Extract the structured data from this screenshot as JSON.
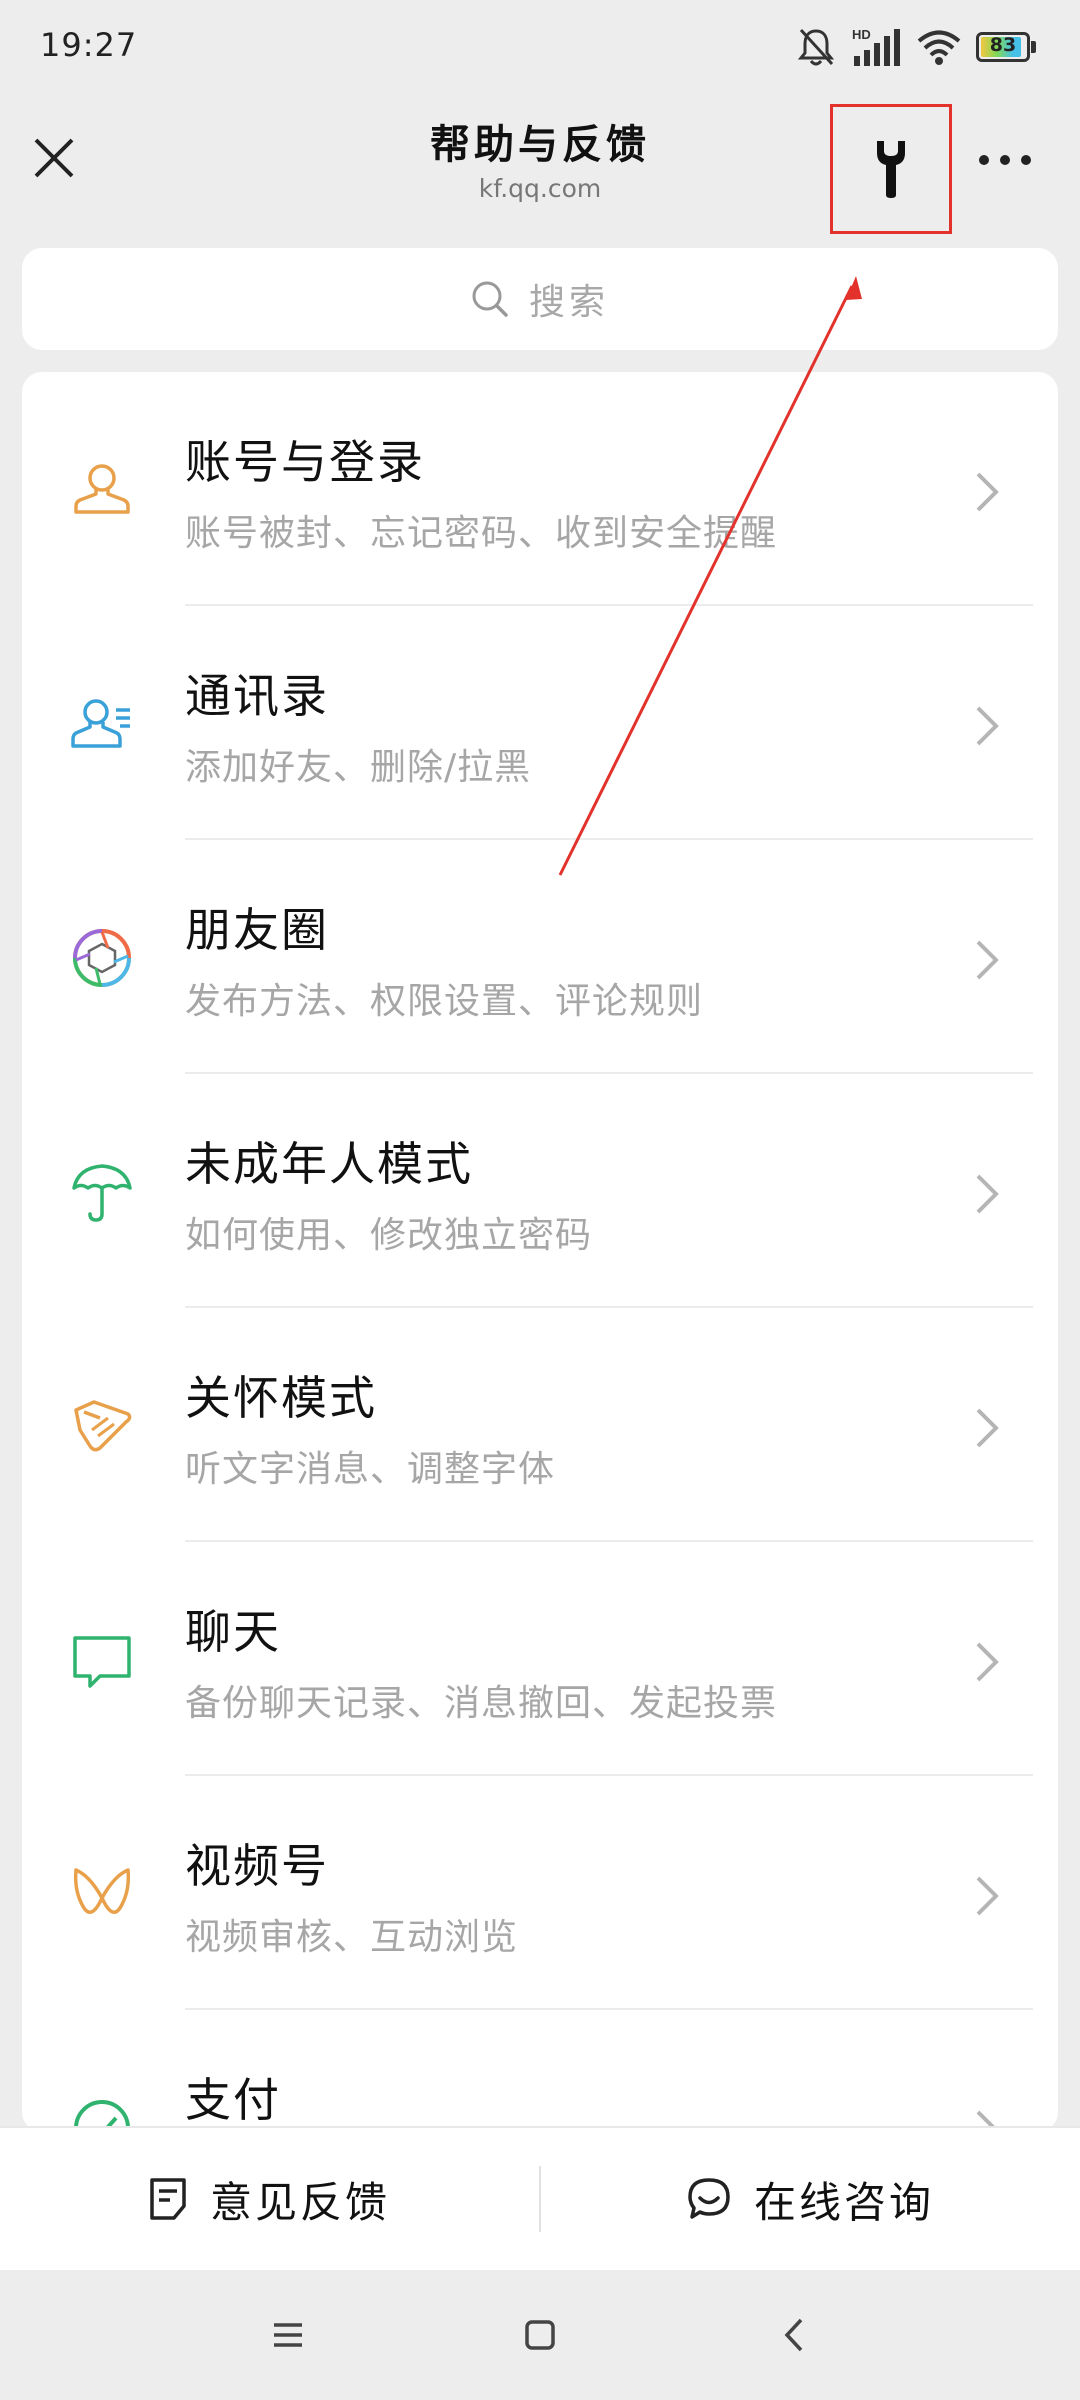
{
  "status_bar": {
    "time": "19:27",
    "network_label": "HD",
    "battery_level": "83",
    "icons": [
      "bell-muted-icon",
      "signal-icon",
      "wifi-icon",
      "battery-icon"
    ]
  },
  "nav": {
    "title": "帮助与反馈",
    "subtitle": "kf.qq.com",
    "icons": [
      "close-icon",
      "wrench-icon",
      "more-icon"
    ],
    "highlight_color": "#e2322b"
  },
  "search": {
    "placeholder": "搜索"
  },
  "help_items": [
    {
      "title": "账号与登录",
      "desc": "账号被封、忘记密码、收到安全提醒",
      "icon": "user-icon",
      "color": "#e8a04a"
    },
    {
      "title": "通讯录",
      "desc": "添加好友、删除/拉黑",
      "icon": "contacts-icon",
      "color": "#3aa0d8"
    },
    {
      "title": "朋友圈",
      "desc": "发布方法、权限设置、评论规则",
      "icon": "moments-icon",
      "color": "multicolor"
    },
    {
      "title": "未成年人模式",
      "desc": "如何使用、修改独立密码",
      "icon": "umbrella-icon",
      "color": "#2fb36e"
    },
    {
      "title": "关怀模式",
      "desc": "听文字消息、调整字体",
      "icon": "care-icon",
      "color": "#e8a04a"
    },
    {
      "title": "聊天",
      "desc": "备份聊天记录、消息撤回、发起投票",
      "icon": "chat-icon",
      "color": "#2fb36e"
    },
    {
      "title": "视频号",
      "desc": "视频审核、互动浏览",
      "icon": "channels-icon",
      "color": "#e8a04a"
    },
    {
      "title": "支付",
      "desc": "",
      "icon": "pay-icon",
      "color": "#2fb36e"
    }
  ],
  "bottom_bar": {
    "feedback_label": "意见反馈",
    "consult_label": "在线咨询",
    "icons": [
      "feedback-doc-icon",
      "chat-bubble-icon"
    ]
  },
  "system_nav": {
    "icons": [
      "menu-icon",
      "home-icon",
      "back-icon"
    ]
  }
}
